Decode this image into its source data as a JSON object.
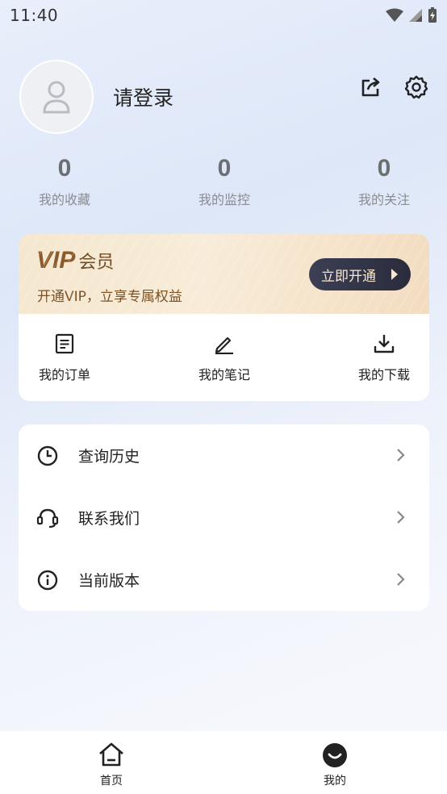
{
  "status_bar": {
    "time": "11:40"
  },
  "profile": {
    "login_text": "请登录"
  },
  "stats": [
    {
      "value": "0",
      "label": "我的收藏"
    },
    {
      "value": "0",
      "label": "我的监控"
    },
    {
      "value": "0",
      "label": "我的关注"
    }
  ],
  "vip": {
    "title": "VIP",
    "member": "会员",
    "subtitle": "开通VIP，立享专属权益",
    "button": "立即开通"
  },
  "quick_actions": [
    {
      "label": "我的订单",
      "icon": "document-icon"
    },
    {
      "label": "我的笔记",
      "icon": "pencil-icon"
    },
    {
      "label": "我的下载",
      "icon": "download-icon"
    }
  ],
  "menu": [
    {
      "label": "查询历史",
      "icon": "clock-icon"
    },
    {
      "label": "联系我们",
      "icon": "headset-icon"
    },
    {
      "label": "当前版本",
      "icon": "info-icon"
    }
  ],
  "tabbar": [
    {
      "label": "首页",
      "icon": "home-icon"
    },
    {
      "label": "我的",
      "icon": "profile-face-icon"
    }
  ],
  "colors": {
    "vip_text": "#8a5a2b",
    "vip_button_bg": "#2f3244",
    "stat_value": "#6b6e73"
  }
}
